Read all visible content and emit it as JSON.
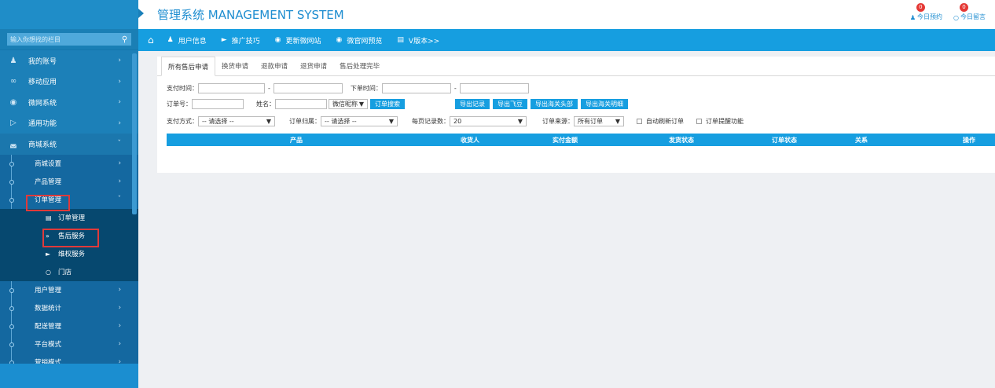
{
  "header": {
    "title": "管理系统 MANAGEMENT SYSTEM",
    "today_booking": {
      "label": "今日预约",
      "count": "0"
    },
    "today_message": {
      "label": "今日留言",
      "count": "0"
    }
  },
  "sidebar": {
    "search_placeholder": "输入你想找的栏目",
    "menu": [
      {
        "label": "我的账号",
        "icon": "user-icon"
      },
      {
        "label": "移动应用",
        "icon": "apps-icon"
      },
      {
        "label": "微网系统",
        "icon": "globe-icon"
      },
      {
        "label": "通用功能",
        "icon": "play-circle-icon"
      },
      {
        "label": "商城系统",
        "icon": "cart-icon"
      }
    ],
    "mall_sub": [
      {
        "label": "商城设置"
      },
      {
        "label": "产品管理"
      },
      {
        "label": "订单管理"
      }
    ],
    "order_leaves": [
      {
        "label": "订单管理",
        "icon": "doc-icon"
      },
      {
        "label": "售后服务",
        "icon": "double-chevron-icon"
      },
      {
        "label": "维权服务",
        "icon": "megaphone-icon"
      },
      {
        "label": "门店",
        "icon": "chat-icon"
      }
    ],
    "mall_sub_after": [
      {
        "label": "用户管理"
      },
      {
        "label": "数据统计"
      },
      {
        "label": "配送管理"
      },
      {
        "label": "平台模式"
      },
      {
        "label": "营销模式"
      }
    ]
  },
  "navbar": {
    "items": [
      {
        "label": "用户信息",
        "icon": "user-icon"
      },
      {
        "label": "推广技巧",
        "icon": "megaphone-icon"
      },
      {
        "label": "更新微网站",
        "icon": "globe-icon"
      },
      {
        "label": "微官网预览",
        "icon": "eye-icon"
      },
      {
        "label": "V版本>>",
        "icon": "printer-icon"
      }
    ]
  },
  "tabs": [
    "所有售后申请",
    "换货申请",
    "退款申请",
    "退货申请",
    "售后处理完毕"
  ],
  "filters": {
    "pay_time_label": "支付时间：",
    "dash": "-",
    "order_time_label": "下单时间：",
    "order_no_label": "订单号：",
    "name_label": "姓名：",
    "wechat_select": "微信昵称",
    "search_button": "订单搜索",
    "export_record": "导出记录",
    "export_feidou": "导出飞豆",
    "export_customs_head": "导出海关头部",
    "export_customs_detail": "导出海关明细",
    "pay_method_label": "支付方式：",
    "pay_method_value": "-- 请选择 --",
    "order_owner_label": "订单归属：",
    "order_owner_value": "-- 请选择 --",
    "per_page_label": "每页记录数：",
    "per_page_value": "20",
    "order_source_label": "订单来源：",
    "order_source_value": "所有订单",
    "auto_refresh": "自动刷新订单",
    "order_remind": "订单提醒功能"
  },
  "table": {
    "columns": [
      "产品",
      "收货人",
      "实付金额",
      "发货状态",
      "订单状态",
      "关系",
      "操作"
    ]
  }
}
